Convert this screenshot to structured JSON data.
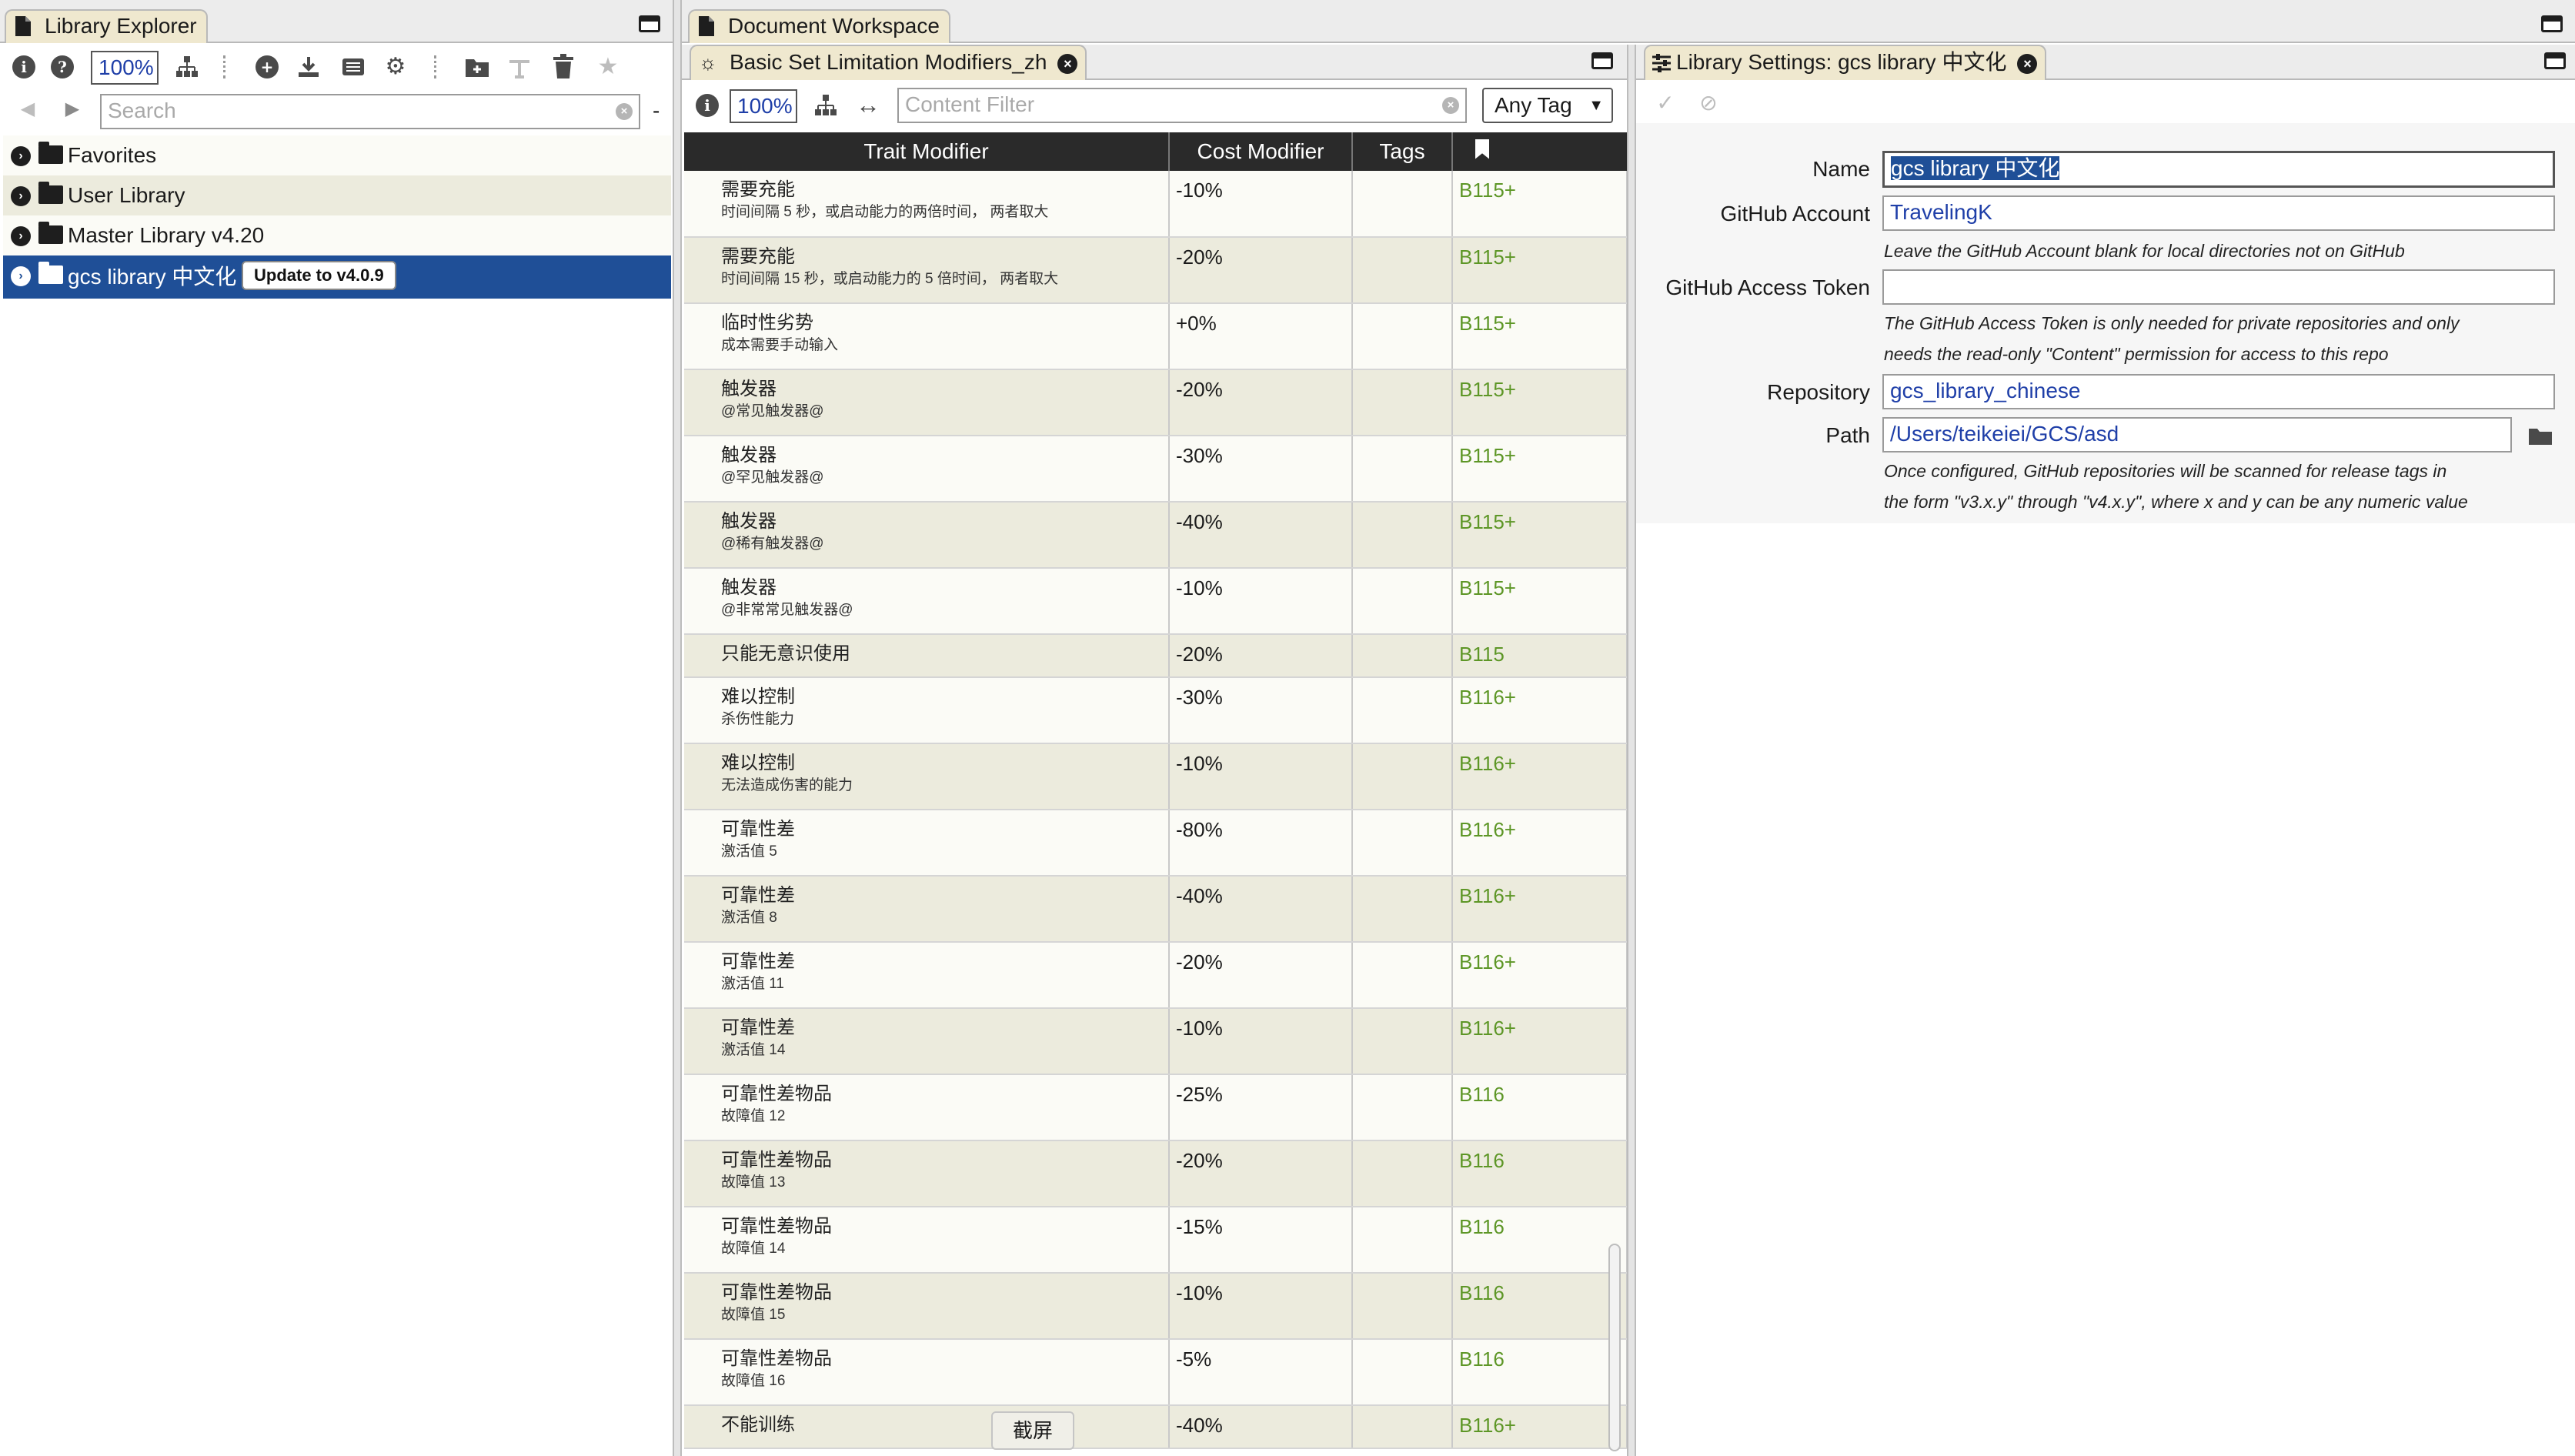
{
  "library_explorer": {
    "tab_title": "Library Explorer",
    "zoom": "100%",
    "search_placeholder": "Search",
    "dash": "-",
    "tree": [
      {
        "label": "Favorites"
      },
      {
        "label": "User Library"
      },
      {
        "label": "Master Library v4.20"
      },
      {
        "label": "gcs library 中文化",
        "update_button": "Update to v4.0.9"
      }
    ]
  },
  "workspace": {
    "tab_title": "Document Workspace",
    "doc_tab": "Basic Set Limitation Modifiers_zh",
    "settings_tab": "Library Settings: gcs library 中文化"
  },
  "document": {
    "zoom": "100%",
    "filter_placeholder": "Content Filter",
    "tag_select": "Any Tag",
    "columns": {
      "trait_modifier": "Trait Modifier",
      "cost_modifier": "Cost Modifier",
      "tags": "Tags"
    },
    "rows": [
      {
        "name": "需要充能",
        "note": "时间间隔 5 秒，或启动能力的两倍时间， 两者取大",
        "cost": "-10%",
        "ref": "B115+"
      },
      {
        "name": "需要充能",
        "note": "时间间隔 15 秒，或启动能力的 5 倍时间， 两者取大",
        "cost": "-20%",
        "ref": "B115+"
      },
      {
        "name": "临时性劣势",
        "note": "成本需要手动输入",
        "cost": "+0%",
        "ref": "B115+"
      },
      {
        "name": "触发器",
        "note": "@常见触发器@",
        "cost": "-20%",
        "ref": "B115+"
      },
      {
        "name": "触发器",
        "note": "@罕见触发器@",
        "cost": "-30%",
        "ref": "B115+"
      },
      {
        "name": "触发器",
        "note": "@稀有触发器@",
        "cost": "-40%",
        "ref": "B115+"
      },
      {
        "name": "触发器",
        "note": "@非常常见触发器@",
        "cost": "-10%",
        "ref": "B115+"
      },
      {
        "name": "只能无意识使用",
        "note": "",
        "cost": "-20%",
        "ref": "B115"
      },
      {
        "name": "难以控制",
        "note": "杀伤性能力",
        "cost": "-30%",
        "ref": "B116+"
      },
      {
        "name": "难以控制",
        "note": "无法造成伤害的能力",
        "cost": "-10%",
        "ref": "B116+"
      },
      {
        "name": "可靠性差",
        "note": "激活值 5",
        "cost": "-80%",
        "ref": "B116+"
      },
      {
        "name": "可靠性差",
        "note": "激活值 8",
        "cost": "-40%",
        "ref": "B116+"
      },
      {
        "name": "可靠性差",
        "note": "激活值 11",
        "cost": "-20%",
        "ref": "B116+"
      },
      {
        "name": "可靠性差",
        "note": "激活值 14",
        "cost": "-10%",
        "ref": "B116+"
      },
      {
        "name": "可靠性差物品",
        "note": "故障值 12",
        "cost": "-25%",
        "ref": "B116"
      },
      {
        "name": "可靠性差物品",
        "note": "故障值 13",
        "cost": "-20%",
        "ref": "B116"
      },
      {
        "name": "可靠性差物品",
        "note": "故障值 14",
        "cost": "-15%",
        "ref": "B116"
      },
      {
        "name": "可靠性差物品",
        "note": "故障值 15",
        "cost": "-10%",
        "ref": "B116"
      },
      {
        "name": "可靠性差物品",
        "note": "故障值 16",
        "cost": "-5%",
        "ref": "B116"
      },
      {
        "name": "不能训练",
        "note": "",
        "cost": "-40%",
        "ref": "B116+"
      }
    ],
    "screenshot_tooltip": "截屏"
  },
  "settings": {
    "name_label": "Name",
    "name_value": "gcs library 中文化",
    "github_account_label": "GitHub Account",
    "github_account_value": "TravelingK",
    "github_account_note": "Leave the GitHub Account blank for local directories not on GitHub",
    "token_label": "GitHub Access Token",
    "token_value": "",
    "token_note_1": "The GitHub Access Token is only needed for private repositories and only",
    "token_note_2": "needs the read-only \"Content\" permission for access to this repo",
    "repository_label": "Repository",
    "repository_value": "gcs_library_chinese",
    "path_label": "Path",
    "path_value": "/Users/teikeiei/GCS/asd",
    "path_note_1": "Once configured, GitHub repositories will be scanned for release tags in",
    "path_note_2": "the form \"v3.x.y\" through \"v4.x.y\", where x and y can be any numeric value"
  },
  "colors": {
    "selection": "#1f4f97",
    "accent_green": "#5d9626",
    "tab_bg": "#efe8cf",
    "row_alt": "#ecebdd",
    "field_text": "#1f3fa8"
  }
}
